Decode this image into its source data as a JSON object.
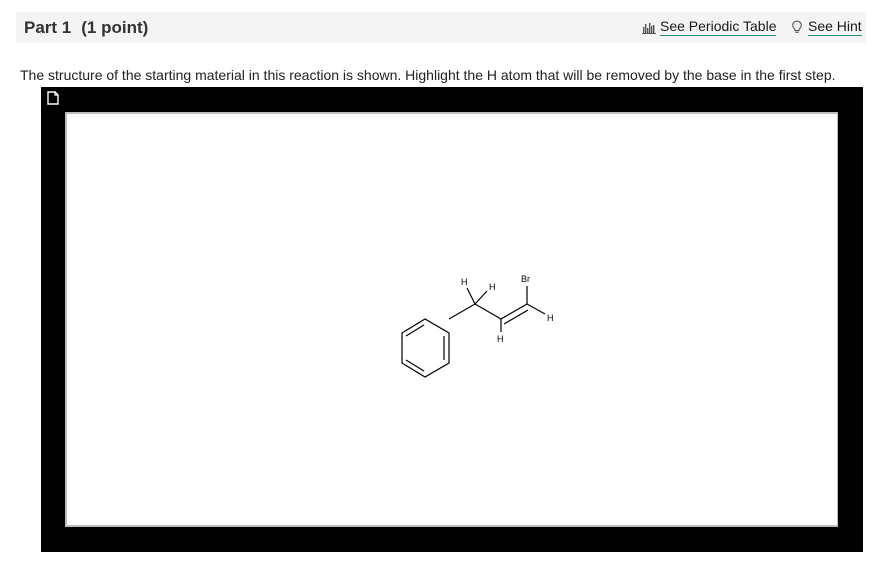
{
  "part": {
    "title": "Part 1",
    "points": "(1 point)"
  },
  "links": {
    "periodic_table": "See Periodic Table",
    "hint": "See Hint"
  },
  "question": {
    "text": "The structure of the starting material in this reaction is shown. Highlight the H atom that will be removed by the base in the first step."
  },
  "editor": {
    "atoms": {
      "h_top_left": "H",
      "h_top_right": "H",
      "br": "Br",
      "h_right": "H",
      "h_bottom": "H"
    }
  },
  "colors": {
    "header_bg": "#f4f4f4",
    "link_underline": "#2a8a7a",
    "editor_frame": "#000000",
    "canvas_bg": "#ffffff"
  },
  "icons": {
    "periodic": "bar-chart-icon",
    "hint": "lightbulb-icon",
    "new_doc": "new-document-icon"
  }
}
